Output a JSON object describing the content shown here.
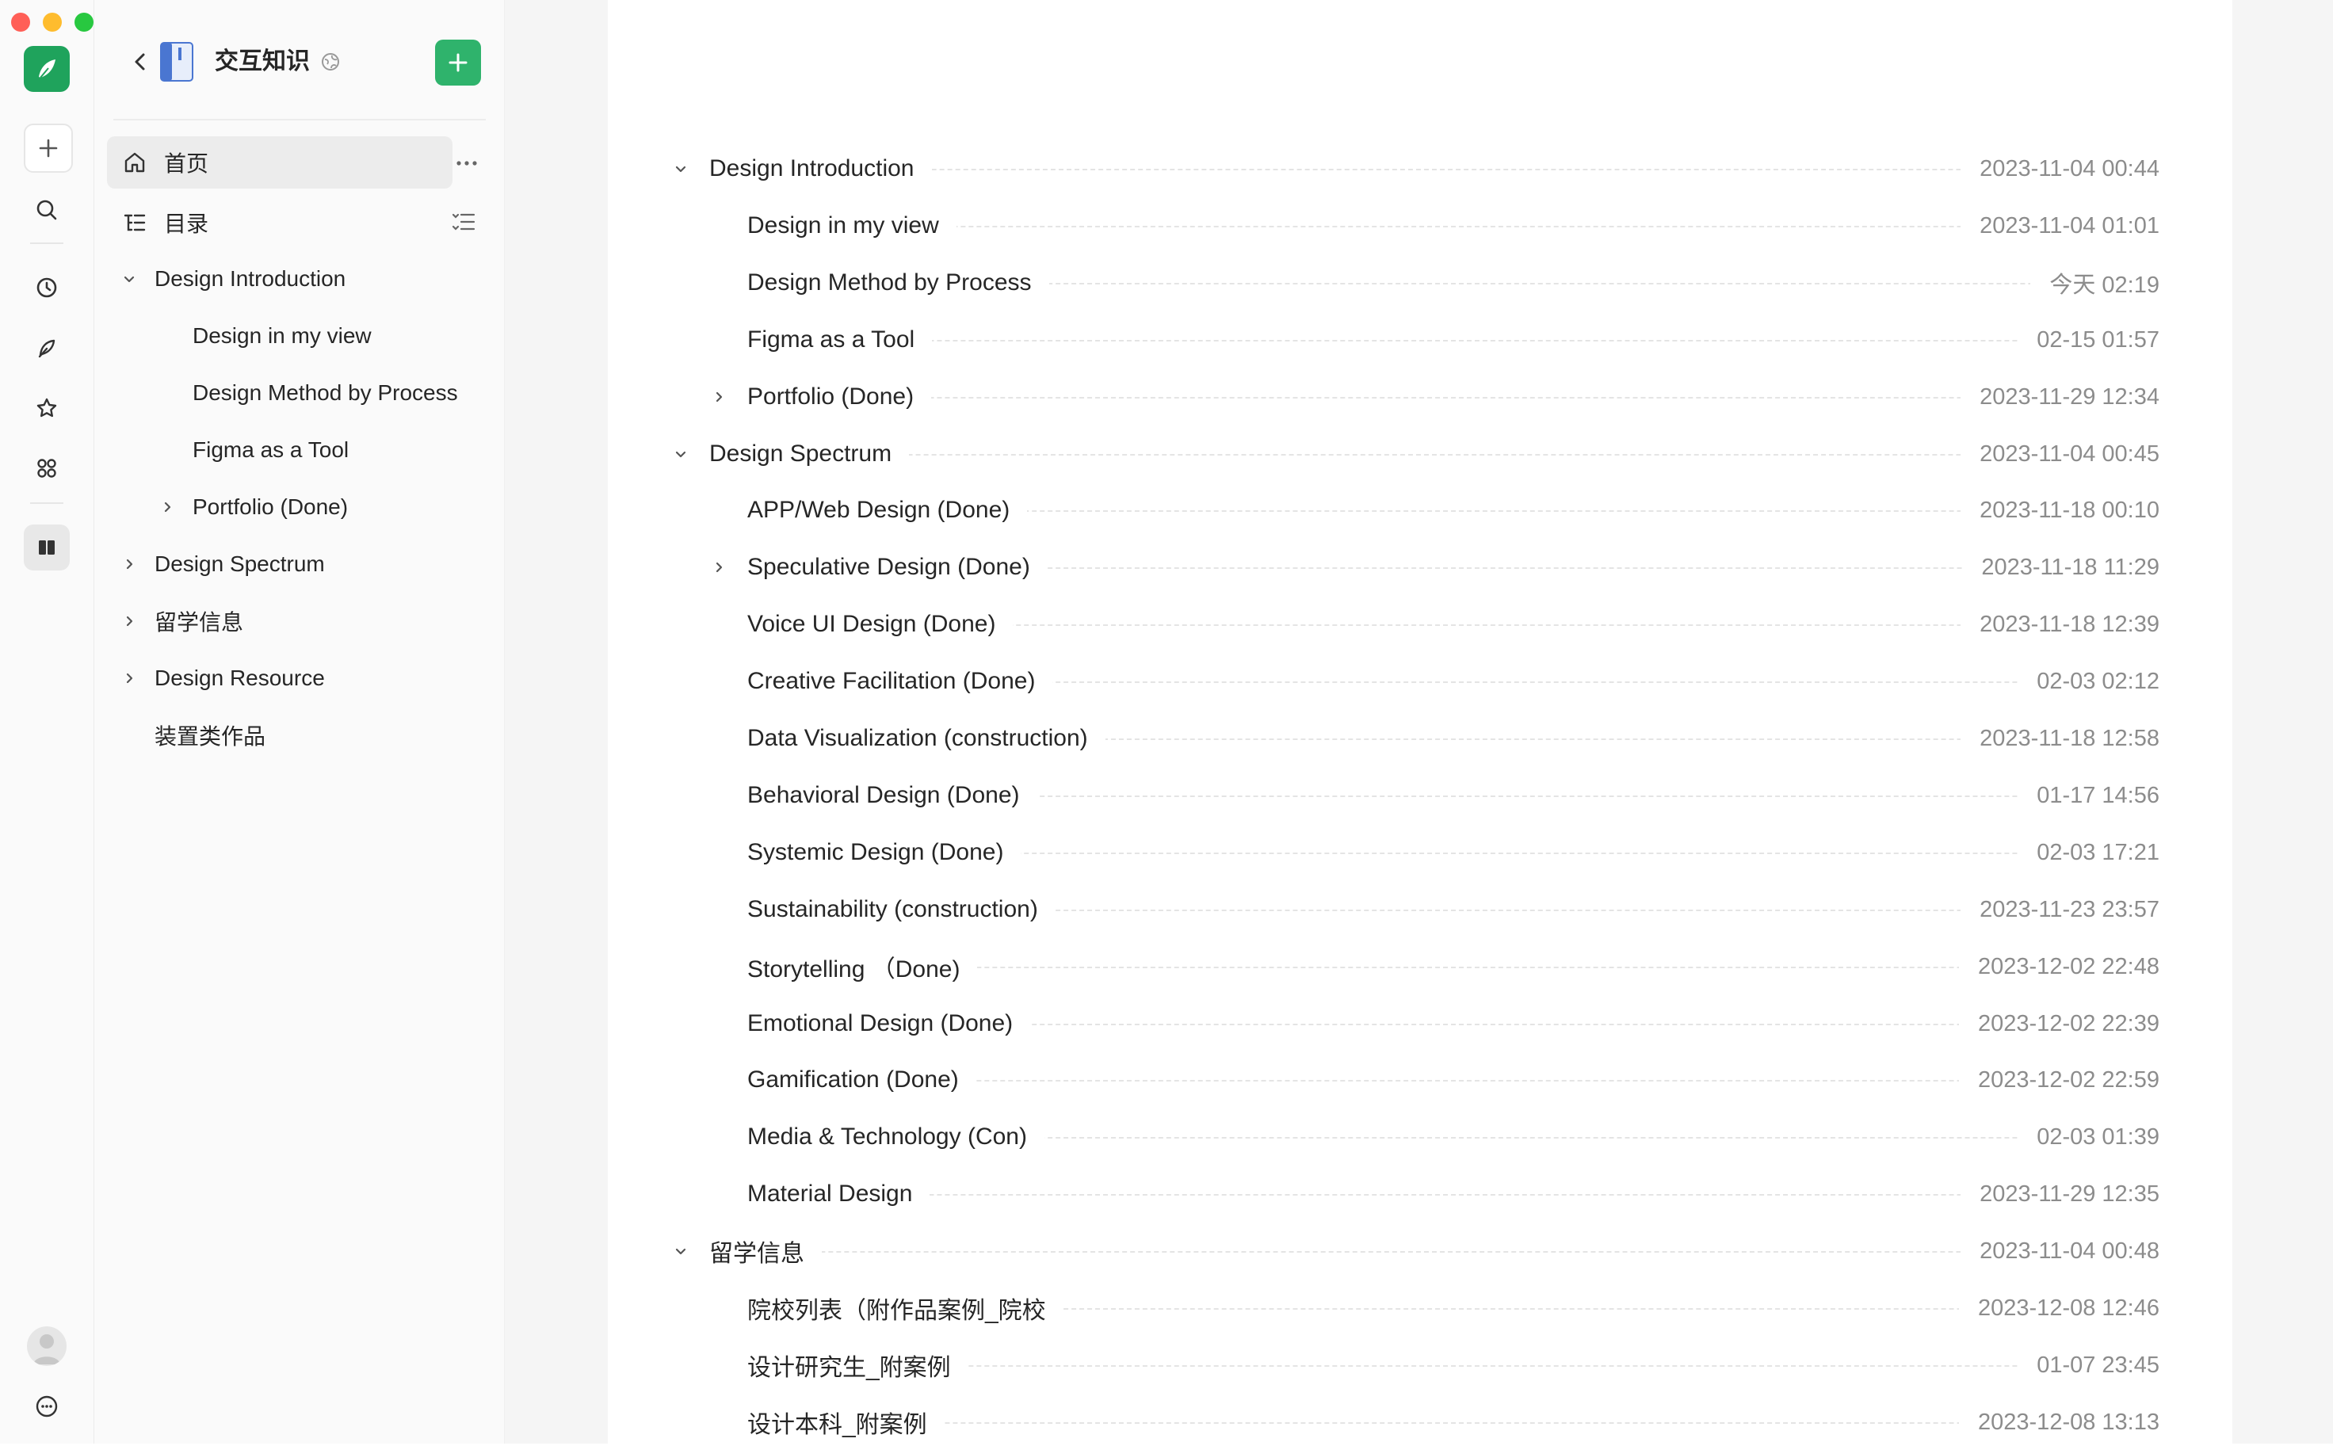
{
  "window": {
    "colors": {
      "close": "#ff5f57",
      "minimize": "#febc2e",
      "zoom": "#28c840"
    }
  },
  "rail": {
    "icons": [
      "app-logo-icon",
      "plus-icon",
      "search-icon",
      "clock-icon",
      "feather-icon",
      "star-icon",
      "apps-icon",
      "book-icon",
      "avatar-icon",
      "more-icon"
    ]
  },
  "sidebar": {
    "title": "交互知识",
    "home_label": "首页",
    "toc_label": "目录",
    "tree": [
      {
        "label": "Design Introduction",
        "expanded": true
      },
      {
        "label": "Design in my view"
      },
      {
        "label": "Design Method by Process"
      },
      {
        "label": "Figma as a Tool"
      },
      {
        "label": "Portfolio (Done)",
        "expanded": false
      },
      {
        "label": "Design Spectrum",
        "expanded": false
      },
      {
        "label": "留学信息",
        "expanded": false
      },
      {
        "label": "Design Resource",
        "expanded": false
      },
      {
        "label": "装置类作品"
      }
    ]
  },
  "toc": {
    "rows": [
      {
        "title": "Design Introduction",
        "date": "2023-11-04 00:44"
      },
      {
        "title": "Design in my view",
        "date": "2023-11-04 01:01"
      },
      {
        "title": "Design Method by Process",
        "date": "今天 02:19"
      },
      {
        "title": "Figma as a Tool",
        "date": "02-15 01:57"
      },
      {
        "title": "Portfolio (Done)",
        "date": "2023-11-29 12:34"
      },
      {
        "title": "Design Spectrum",
        "date": "2023-11-04 00:45"
      },
      {
        "title": "APP/Web Design (Done)",
        "date": "2023-11-18 00:10"
      },
      {
        "title": "Speculative Design (Done)",
        "date": "2023-11-18 11:29"
      },
      {
        "title": "Voice UI Design (Done)",
        "date": "2023-11-18 12:39"
      },
      {
        "title": "Creative Facilitation (Done)",
        "date": "02-03 02:12"
      },
      {
        "title": "Data Visualization (construction)",
        "date": "2023-11-18 12:58"
      },
      {
        "title": "Behavioral Design (Done)",
        "date": "01-17 14:56"
      },
      {
        "title": "Systemic Design (Done)",
        "date": "02-03 17:21"
      },
      {
        "title": "Sustainability (construction)",
        "date": "2023-11-23 23:57"
      },
      {
        "title": "Storytelling （Done)",
        "date": "2023-12-02 22:48"
      },
      {
        "title": "Emotional Design (Done)",
        "date": "2023-12-02 22:39"
      },
      {
        "title": "Gamification (Done)",
        "date": "2023-12-02 22:59"
      },
      {
        "title": "Media & Technology (Con)",
        "date": "02-03 01:39"
      },
      {
        "title": "Material Design",
        "date": "2023-11-29 12:35"
      },
      {
        "title": "留学信息",
        "date": "2023-11-04 00:48"
      },
      {
        "title": "院校列表（附作品案例_院校",
        "date": "2023-12-08 12:46"
      },
      {
        "title": "设计研究生_附案例",
        "date": "01-07 23:45"
      },
      {
        "title": "设计本科_附案例",
        "date": "2023-12-08 13:13"
      }
    ]
  },
  "colors": {
    "accent": "#2fb36c",
    "text": "#262626",
    "muted": "#8c8c8c"
  }
}
